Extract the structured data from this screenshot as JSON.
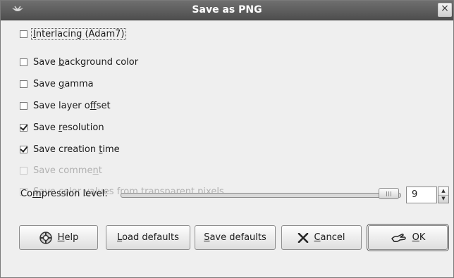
{
  "window": {
    "title": "Save as PNG",
    "close_glyph": "×"
  },
  "options": [
    {
      "pre": "",
      "mn": "I",
      "post": "nterlacing (Adam7)",
      "checked": false,
      "enabled": true,
      "focused": true
    },
    {
      "pre": "Save ",
      "mn": "b",
      "post": "ackground color",
      "checked": false,
      "enabled": true
    },
    {
      "pre": "Save ",
      "mn": "g",
      "post": "amma",
      "checked": false,
      "enabled": true
    },
    {
      "pre": "Save layer o",
      "mn": "f",
      "post": "fset",
      "checked": false,
      "enabled": true
    },
    {
      "pre": "Save ",
      "mn": "r",
      "post": "esolution",
      "checked": true,
      "enabled": true
    },
    {
      "pre": "Save creation ",
      "mn": "t",
      "post": "ime",
      "checked": true,
      "enabled": true
    },
    {
      "pre": "Save comme",
      "mn": "n",
      "post": "t",
      "checked": false,
      "enabled": false
    },
    {
      "pre": "Save color ",
      "mn": "v",
      "post": "alues from transparent pixels",
      "checked": false,
      "enabled": false
    }
  ],
  "compression": {
    "pre": "Co",
    "mn": "m",
    "post": "pression level:",
    "value": "9",
    "max": 9
  },
  "buttons": {
    "help": {
      "mn": "H",
      "post": "elp",
      "icon": "help-lifebuoy-icon"
    },
    "load": {
      "mn": "L",
      "post": "oad defaults"
    },
    "save": {
      "mn": "S",
      "post": "ave defaults"
    },
    "cancel": {
      "mn": "C",
      "post": "ancel",
      "icon": "cancel-x-icon"
    },
    "ok": {
      "mn": "O",
      "post": "K",
      "icon": "ok-hand-icon"
    }
  }
}
